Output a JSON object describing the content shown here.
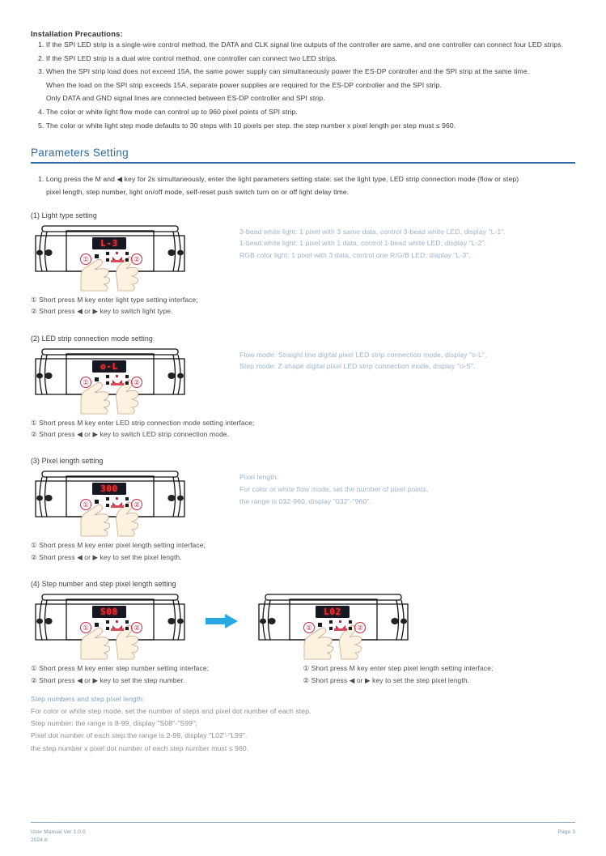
{
  "precautions": {
    "heading": "Installation Precautions:",
    "items": [
      "1. If the SPI LED strip is a single-wire control method, the DATA and CLK signal line outputs of the controller are same, and one controller can connect four LED strips.",
      "2. If the SPI LED strip is a dual wire control method, one controller can connect two LED strips.",
      "3. When the SPI strip load does not exceed 15A, the same power supply can simultaneously power the ES-DP controller and the SPI strip at the same time.",
      "When the load on the SPI strip exceeds 15A, separate power supplies are required for the ES-DP controller and the SPI strip.",
      "Only DATA and GND signal lines are connected between ES-DP controller and SPI strip.",
      "4. The color or white light flow mode can control up to 960 pixel points of SPI strip.",
      "5. The color or white light step mode defaults to 30 steps with 10 pixels per step. the step number x pixel length per step must ≤ 960."
    ]
  },
  "section": {
    "title": "Parameters Setting",
    "accent_color": "#2e6ca4",
    "intro_line1": "1. Long press the M and ◀ key for 2s simultaneously, enter the light parameters setting state: set the light type, LED strip connection mode (flow or step)",
    "intro_line2": "pixel length, step number, light on/off mode, self-reset push switch turn on or off light delay time."
  },
  "sub1": {
    "heading": "(1) Light type setting",
    "display": "L-3",
    "marker1": "①",
    "marker2": "②",
    "desc": [
      "3-bead white light: 1 pixel with 3 same data, control 3-bead white LED, display \"L-1\".",
      "1-bead white light: 1 pixel with 1 data, control 1-bead white LED, display \"L-2\".",
      "RGB color light: 1 pixel with 3 data, control one R/G/B LED, display \"L-3\"."
    ],
    "steps": [
      "① Short press M key enter light type setting interface;",
      "② Short press ◀ or ▶ key to switch light type."
    ]
  },
  "sub2": {
    "heading": "(2) LED strip connection mode setting",
    "display": "o-L",
    "marker1": "①",
    "marker2": "②",
    "desc": [
      "Flow mode: Straight line digital pixel LED strip connection mode, display \"o-L\".",
      "Step mode: Z-shape digital pixel LED strip connection mode, display \"o-S\"."
    ],
    "steps": [
      "① Short press M key enter LED strip connection mode setting interface;",
      "② Short press ◀ or ▶ key to switch LED strip connection mode."
    ]
  },
  "sub3": {
    "heading": "(3) Pixel length setting",
    "display": "300",
    "marker1": "①",
    "marker2": "②",
    "desc": [
      "Pixel length:",
      "For color or white flow mode, set the number of pixel points,",
      "the range is 032-960, display \"032\"-\"960\"."
    ],
    "steps": [
      "① Short press M key enter pixel length setting interface;",
      "② Short press ◀ or ▶ key to set the pixel length."
    ]
  },
  "sub4": {
    "heading": "(4) Step number and step pixel length setting",
    "display_left": "S08",
    "display_right": "L02",
    "marker1": "①",
    "marker2": "②",
    "arrow_color": "#28a8e0",
    "steps_left": [
      "① Short press M key enter step number setting interface;",
      "② Short press ◀ or ▶ key to set the step number."
    ],
    "steps_right": [
      "① Short press M key enter step pixel length setting interface;",
      "② Short press ◀ or ▶ key to set the step pixel length."
    ],
    "notes_title": "Step numbers and step pixel length:",
    "notes": [
      "For color or white step mode, set the number of steps and pixel dot number of each step.",
      "Step number: the range is 8-99, display \"S08\"-\"S99\";",
      "Pixel dot number of each step:the range is 2-99, display \"L02\"-\"L99\".",
      "the step number x pixel dot number of each step number must ≤ 960."
    ]
  },
  "footer": {
    "line1": "User Manual Ver 1.0.0",
    "line2": "2024.6",
    "page": "Page 3"
  }
}
